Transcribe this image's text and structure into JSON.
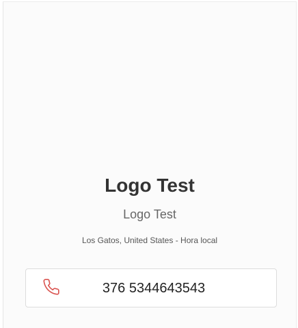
{
  "profile": {
    "name": "Logo Test",
    "subtitle": "Logo Test",
    "location": "Los Gatos, United States - Hora local"
  },
  "contact": {
    "phone": "376 5344643543",
    "phone_icon": "phone-icon",
    "accent_color": "#d9534f"
  }
}
